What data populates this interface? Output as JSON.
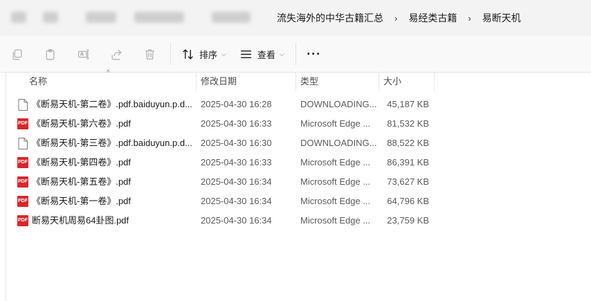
{
  "breadcrumb": {
    "items": [
      "流失海外的中华古籍汇总",
      "易经类古籍",
      "易断天机"
    ],
    "separator": "›"
  },
  "toolbar": {
    "icons": [
      "copy-icon",
      "paste-icon",
      "rename-icon",
      "share-icon",
      "delete-icon"
    ],
    "sort_label": "排序",
    "view_label": "查看",
    "more_label": "···"
  },
  "columns": {
    "name": "名称",
    "date": "修改日期",
    "type": "类型",
    "size": "大小"
  },
  "files": [
    {
      "name": "《断易天机-第二卷》.pdf.baiduyun.p.d...",
      "date": "2025-04-30 16:28",
      "type": "DOWNLOADING...",
      "size": "45,187 KB",
      "icon": "file-icon"
    },
    {
      "name": "《断易天机-第六卷》.pdf",
      "date": "2025-04-30 16:33",
      "type": "Microsoft Edge ...",
      "size": "81,532 KB",
      "icon": "pdf-icon"
    },
    {
      "name": "《断易天机-第三卷》.pdf.baiduyun.p.d...",
      "date": "2025-04-30 16:30",
      "type": "DOWNLOADING...",
      "size": "88,522 KB",
      "icon": "file-icon"
    },
    {
      "name": "《断易天机-第四卷》.pdf",
      "date": "2025-04-30 16:33",
      "type": "Microsoft Edge ...",
      "size": "86,391 KB",
      "icon": "pdf-icon"
    },
    {
      "name": "《断易天机-第五卷》.pdf",
      "date": "2025-04-30 16:34",
      "type": "Microsoft Edge ...",
      "size": "73,627 KB",
      "icon": "pdf-icon"
    },
    {
      "name": "《断易天机-第一卷》.pdf",
      "date": "2025-04-30 16:34",
      "type": "Microsoft Edge ...",
      "size": "64,796 KB",
      "icon": "pdf-icon"
    },
    {
      "name": "断易天机周易64卦图.pdf",
      "date": "2025-04-30 16:34",
      "type": "Microsoft Edge ...",
      "size": "23,759 KB",
      "icon": "pdf-icon"
    }
  ],
  "pdf_badge": "PDF"
}
